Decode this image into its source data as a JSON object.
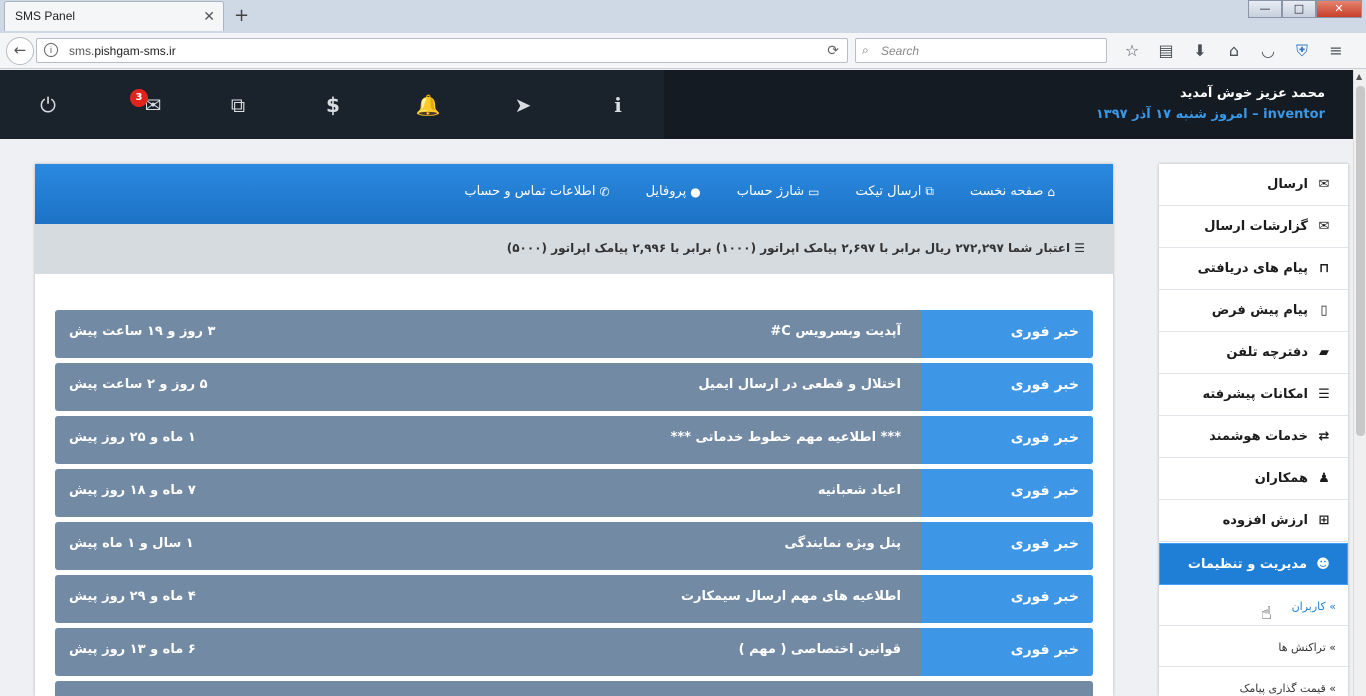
{
  "browser": {
    "tab_title": "SMS Panel",
    "url_prefix": "sms.",
    "url_domain": "pishgam-sms.ir",
    "search_placeholder": "Search",
    "win_min": "—",
    "win_max": "□",
    "win_close": "✕"
  },
  "header": {
    "welcome": "محمد عزیز خوش آمدید",
    "username": "inventor",
    "date_text": " – امروز شنبه ۱۷ آذر ۱۳۹۷",
    "message_count": "3",
    "icons": [
      "power-icon",
      "envelope-icon",
      "ticket-icon",
      "dollar-icon",
      "bell-icon",
      "paper-plane-icon",
      "info-icon"
    ]
  },
  "topnav": {
    "home": "صفحه نخست",
    "ticket": "ارسال تیکت",
    "charge": "شارژ حساب",
    "profile": "پروفایل",
    "contact": "اطلاعات تماس و حساب"
  },
  "credit": {
    "text": "اعتبار شما ۲۷۲,۲۹۷ ریال برابر با ۲,۶۹۷ پیامک اپراتور (۱۰۰۰) برابر با ۲,۹۹۶ پیامک اپراتور (۵۰۰۰)"
  },
  "news": [
    {
      "tag": "خبر فوری",
      "title": "آپدیت وبسرویس C#",
      "time": "۳ روز و ۱۹ ساعت پیش"
    },
    {
      "tag": "خبر فوری",
      "title": "اختلال و قطعی در ارسال ایمیل",
      "time": "۵ روز و ۲ ساعت پیش"
    },
    {
      "tag": "خبر فوری",
      "title": "*** اطلاعیه مهم خطوط خدماتی ***",
      "time": "۱ ماه و ۲۵ روز پیش"
    },
    {
      "tag": "خبر فوری",
      "title": "اعیاد شعبانیه",
      "time": "۷ ماه و ۱۸ روز پیش"
    },
    {
      "tag": "خبر فوری",
      "title": "پنل ویژه نمایندگی",
      "time": "۱ سال و ۱ ماه پیش"
    },
    {
      "tag": "خبر فوری",
      "title": "اطلاعیه های مهم ارسال سیمکارت",
      "time": "۴ ماه و ۲۹ روز پیش"
    },
    {
      "tag": "خبر فوری",
      "title": "قوانین اختصاصی ( مهم )",
      "time": "۶ ماه و ۱۳ روز پیش"
    }
  ],
  "sidebar": {
    "items": [
      {
        "label": "ارسال",
        "icon": "envelope-solid-icon"
      },
      {
        "label": "گزارشات ارسال",
        "icon": "envelope-outline-icon"
      },
      {
        "label": "پیام های دریافتی",
        "icon": "inbox-icon"
      },
      {
        "label": "پیام پیش فرض",
        "icon": "tablet-icon"
      },
      {
        "label": "دفترچه تلفن",
        "icon": "book-icon"
      },
      {
        "label": "امکانات پیشرفته",
        "icon": "server-icon"
      },
      {
        "label": "خدمات هوشمند",
        "icon": "retweet-icon"
      },
      {
        "label": "همکاران",
        "icon": "user-tie-icon"
      },
      {
        "label": "ارزش افزوده",
        "icon": "plus-square-icon"
      },
      {
        "label": "مدیریت و تنظیمات",
        "icon": "users-icon"
      }
    ],
    "sub_items": [
      "کاربران",
      "تراکنش ها",
      "قیمت گذاری پیامک"
    ]
  }
}
